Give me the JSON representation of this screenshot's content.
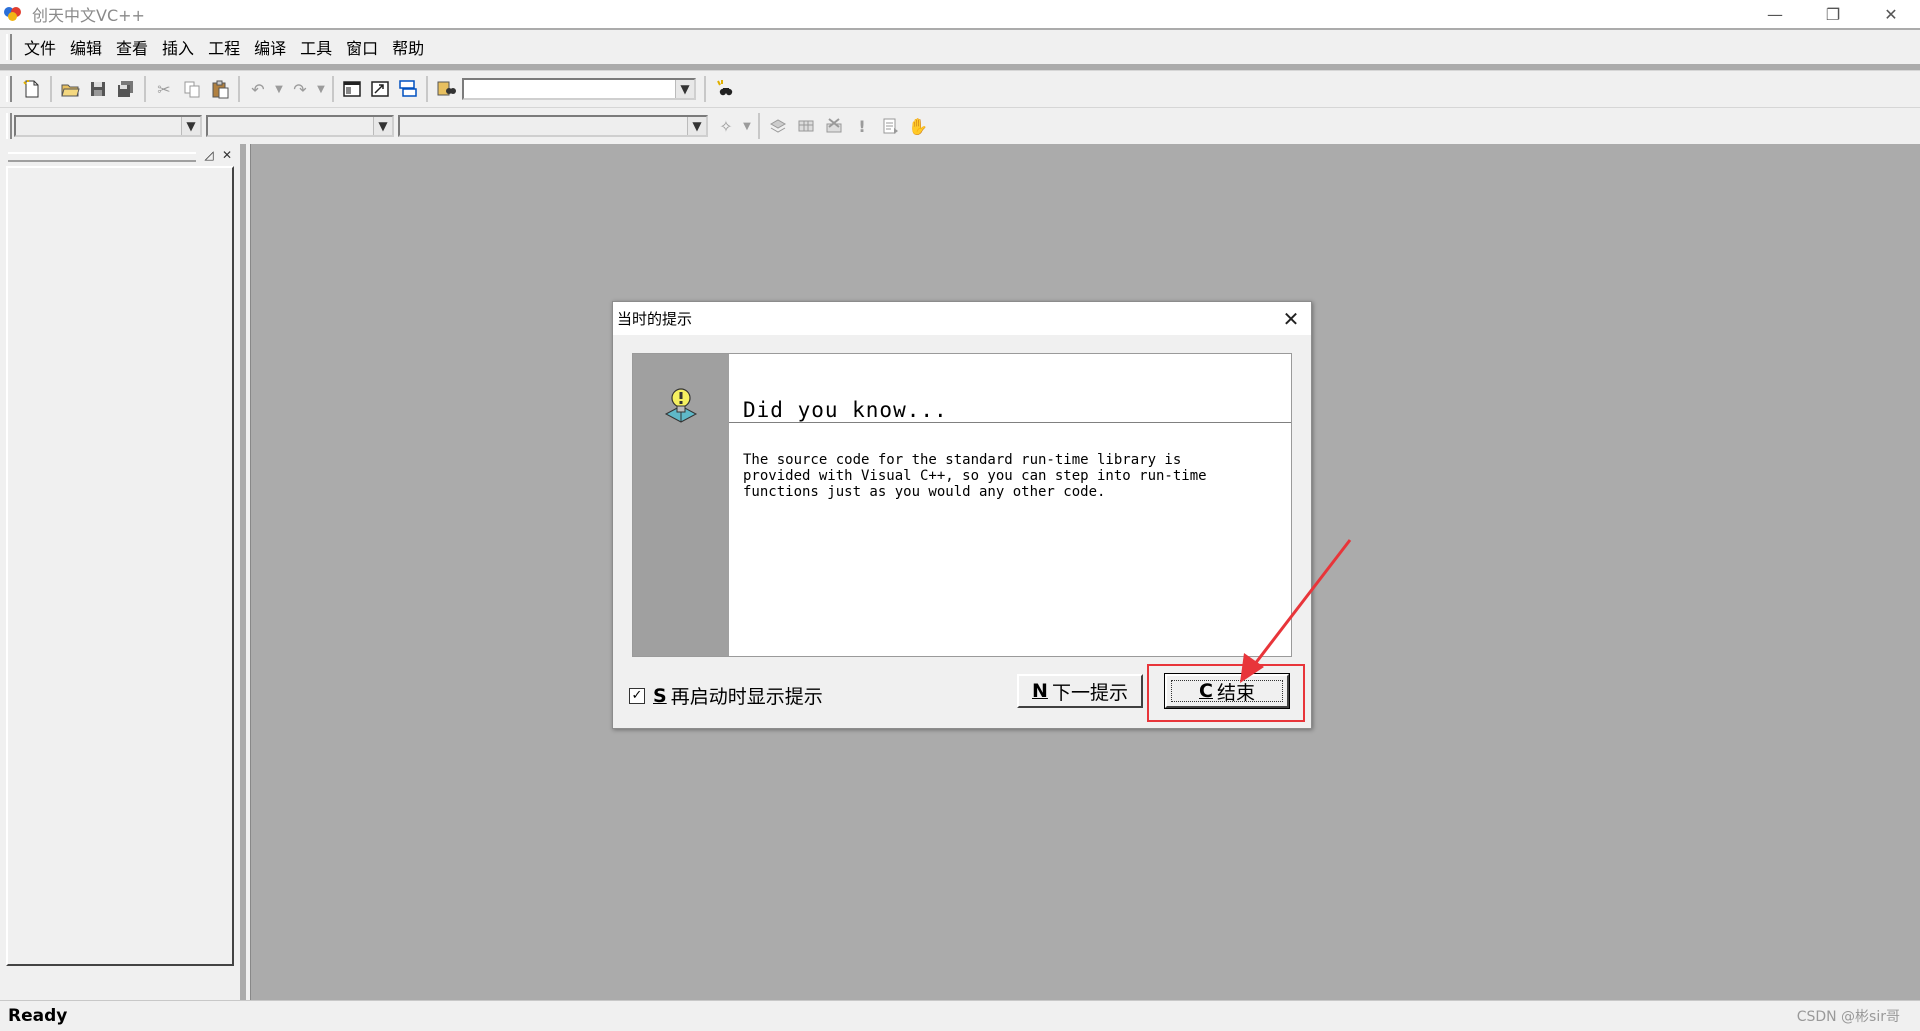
{
  "window": {
    "title": "创天中文VC++",
    "controls": {
      "minimize": "—",
      "restore": "❐",
      "close": "✕"
    }
  },
  "menubar": {
    "items": [
      "文件",
      "编辑",
      "查看",
      "插入",
      "工程",
      "编译",
      "工具",
      "窗口",
      "帮助"
    ]
  },
  "toolbar": {
    "icons": [
      "new-file-icon",
      "open-folder-icon",
      "save-icon",
      "save-all-icon",
      "cut-icon",
      "copy-icon",
      "paste-icon",
      "undo-icon",
      "redo-icon",
      "workspace-icon",
      "output-icon",
      "window-list-icon",
      "find-in-files-icon",
      "search-icon"
    ],
    "find_combo_value": ""
  },
  "toolbar2": {
    "combo_values": [
      "",
      "",
      ""
    ],
    "icons": [
      "wizard-icon",
      "compile-icon",
      "build-icon",
      "stop-build-icon",
      "execute-icon",
      "go-icon",
      "breakpoint-hand-icon"
    ]
  },
  "statusbar": {
    "text": "Ready",
    "watermark": "CSDN @彬sir哥"
  },
  "dialog": {
    "title": "当时的提示",
    "heading": "Did you know...",
    "body": "The source code for the standard run-time library is\nprovided with Visual C++, so you can step into run-time\nfunctions just as you would any other code.",
    "checkbox": {
      "key": "S",
      "label": "再启动时显示提示",
      "checked": true
    },
    "next_button": {
      "key": "N",
      "label": "下一提示"
    },
    "close_button": {
      "key": "C",
      "label": "结束"
    }
  },
  "colors": {
    "workspace_bg": "#ababab",
    "chrome_bg": "#f0f0f0",
    "highlight": "#e8353a"
  }
}
